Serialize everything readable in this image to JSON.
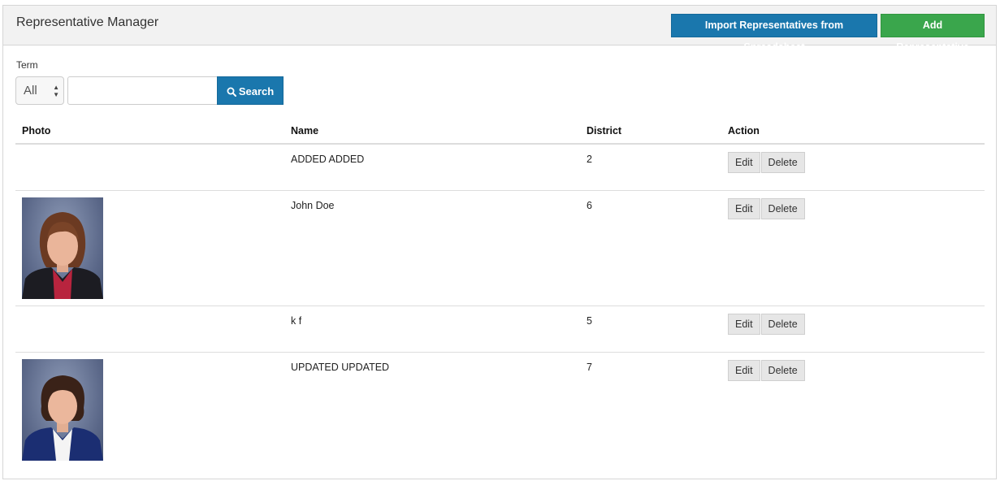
{
  "header": {
    "title": "Representative Manager",
    "import_label": "Import Representatives from Spreadsheet",
    "add_label": "Add Representative",
    "import_color": "#1a77ad",
    "add_color": "#3aa64c"
  },
  "filter": {
    "term_label": "Term",
    "term_selected": "All",
    "search_value": "",
    "search_label": "Search"
  },
  "table": {
    "columns": [
      "Photo",
      "Name",
      "District",
      "Action"
    ],
    "rows": [
      {
        "name": "ADDED ADDED",
        "district": "2",
        "has_photo": false
      },
      {
        "name": "John Doe",
        "district": "6",
        "has_photo": true
      },
      {
        "name": "k f",
        "district": "5",
        "has_photo": false
      },
      {
        "name": "UPDATED UPDATED",
        "district": "7",
        "has_photo": true
      }
    ],
    "edit_label": "Edit",
    "delete_label": "Delete"
  }
}
